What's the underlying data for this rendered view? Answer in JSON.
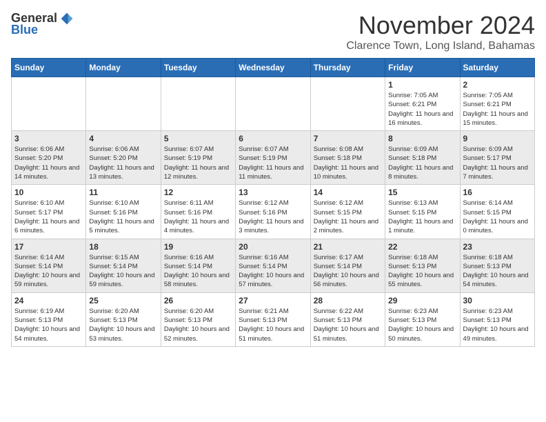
{
  "logo": {
    "general": "General",
    "blue": "Blue"
  },
  "title": "November 2024",
  "location": "Clarence Town, Long Island, Bahamas",
  "weekdays": [
    "Sunday",
    "Monday",
    "Tuesday",
    "Wednesday",
    "Thursday",
    "Friday",
    "Saturday"
  ],
  "weeks": [
    [
      {
        "day": "",
        "info": ""
      },
      {
        "day": "",
        "info": ""
      },
      {
        "day": "",
        "info": ""
      },
      {
        "day": "",
        "info": ""
      },
      {
        "day": "",
        "info": ""
      },
      {
        "day": "1",
        "info": "Sunrise: 7:05 AM\nSunset: 6:21 PM\nDaylight: 11 hours and 16 minutes."
      },
      {
        "day": "2",
        "info": "Sunrise: 7:05 AM\nSunset: 6:21 PM\nDaylight: 11 hours and 15 minutes."
      }
    ],
    [
      {
        "day": "3",
        "info": "Sunrise: 6:06 AM\nSunset: 5:20 PM\nDaylight: 11 hours and 14 minutes."
      },
      {
        "day": "4",
        "info": "Sunrise: 6:06 AM\nSunset: 5:20 PM\nDaylight: 11 hours and 13 minutes."
      },
      {
        "day": "5",
        "info": "Sunrise: 6:07 AM\nSunset: 5:19 PM\nDaylight: 11 hours and 12 minutes."
      },
      {
        "day": "6",
        "info": "Sunrise: 6:07 AM\nSunset: 5:19 PM\nDaylight: 11 hours and 11 minutes."
      },
      {
        "day": "7",
        "info": "Sunrise: 6:08 AM\nSunset: 5:18 PM\nDaylight: 11 hours and 10 minutes."
      },
      {
        "day": "8",
        "info": "Sunrise: 6:09 AM\nSunset: 5:18 PM\nDaylight: 11 hours and 8 minutes."
      },
      {
        "day": "9",
        "info": "Sunrise: 6:09 AM\nSunset: 5:17 PM\nDaylight: 11 hours and 7 minutes."
      }
    ],
    [
      {
        "day": "10",
        "info": "Sunrise: 6:10 AM\nSunset: 5:17 PM\nDaylight: 11 hours and 6 minutes."
      },
      {
        "day": "11",
        "info": "Sunrise: 6:10 AM\nSunset: 5:16 PM\nDaylight: 11 hours and 5 minutes."
      },
      {
        "day": "12",
        "info": "Sunrise: 6:11 AM\nSunset: 5:16 PM\nDaylight: 11 hours and 4 minutes."
      },
      {
        "day": "13",
        "info": "Sunrise: 6:12 AM\nSunset: 5:16 PM\nDaylight: 11 hours and 3 minutes."
      },
      {
        "day": "14",
        "info": "Sunrise: 6:12 AM\nSunset: 5:15 PM\nDaylight: 11 hours and 2 minutes."
      },
      {
        "day": "15",
        "info": "Sunrise: 6:13 AM\nSunset: 5:15 PM\nDaylight: 11 hours and 1 minute."
      },
      {
        "day": "16",
        "info": "Sunrise: 6:14 AM\nSunset: 5:15 PM\nDaylight: 11 hours and 0 minutes."
      }
    ],
    [
      {
        "day": "17",
        "info": "Sunrise: 6:14 AM\nSunset: 5:14 PM\nDaylight: 10 hours and 59 minutes."
      },
      {
        "day": "18",
        "info": "Sunrise: 6:15 AM\nSunset: 5:14 PM\nDaylight: 10 hours and 59 minutes."
      },
      {
        "day": "19",
        "info": "Sunrise: 6:16 AM\nSunset: 5:14 PM\nDaylight: 10 hours and 58 minutes."
      },
      {
        "day": "20",
        "info": "Sunrise: 6:16 AM\nSunset: 5:14 PM\nDaylight: 10 hours and 57 minutes."
      },
      {
        "day": "21",
        "info": "Sunrise: 6:17 AM\nSunset: 5:14 PM\nDaylight: 10 hours and 56 minutes."
      },
      {
        "day": "22",
        "info": "Sunrise: 6:18 AM\nSunset: 5:13 PM\nDaylight: 10 hours and 55 minutes."
      },
      {
        "day": "23",
        "info": "Sunrise: 6:18 AM\nSunset: 5:13 PM\nDaylight: 10 hours and 54 minutes."
      }
    ],
    [
      {
        "day": "24",
        "info": "Sunrise: 6:19 AM\nSunset: 5:13 PM\nDaylight: 10 hours and 54 minutes."
      },
      {
        "day": "25",
        "info": "Sunrise: 6:20 AM\nSunset: 5:13 PM\nDaylight: 10 hours and 53 minutes."
      },
      {
        "day": "26",
        "info": "Sunrise: 6:20 AM\nSunset: 5:13 PM\nDaylight: 10 hours and 52 minutes."
      },
      {
        "day": "27",
        "info": "Sunrise: 6:21 AM\nSunset: 5:13 PM\nDaylight: 10 hours and 51 minutes."
      },
      {
        "day": "28",
        "info": "Sunrise: 6:22 AM\nSunset: 5:13 PM\nDaylight: 10 hours and 51 minutes."
      },
      {
        "day": "29",
        "info": "Sunrise: 6:23 AM\nSunset: 5:13 PM\nDaylight: 10 hours and 50 minutes."
      },
      {
        "day": "30",
        "info": "Sunrise: 6:23 AM\nSunset: 5:13 PM\nDaylight: 10 hours and 49 minutes."
      }
    ]
  ]
}
